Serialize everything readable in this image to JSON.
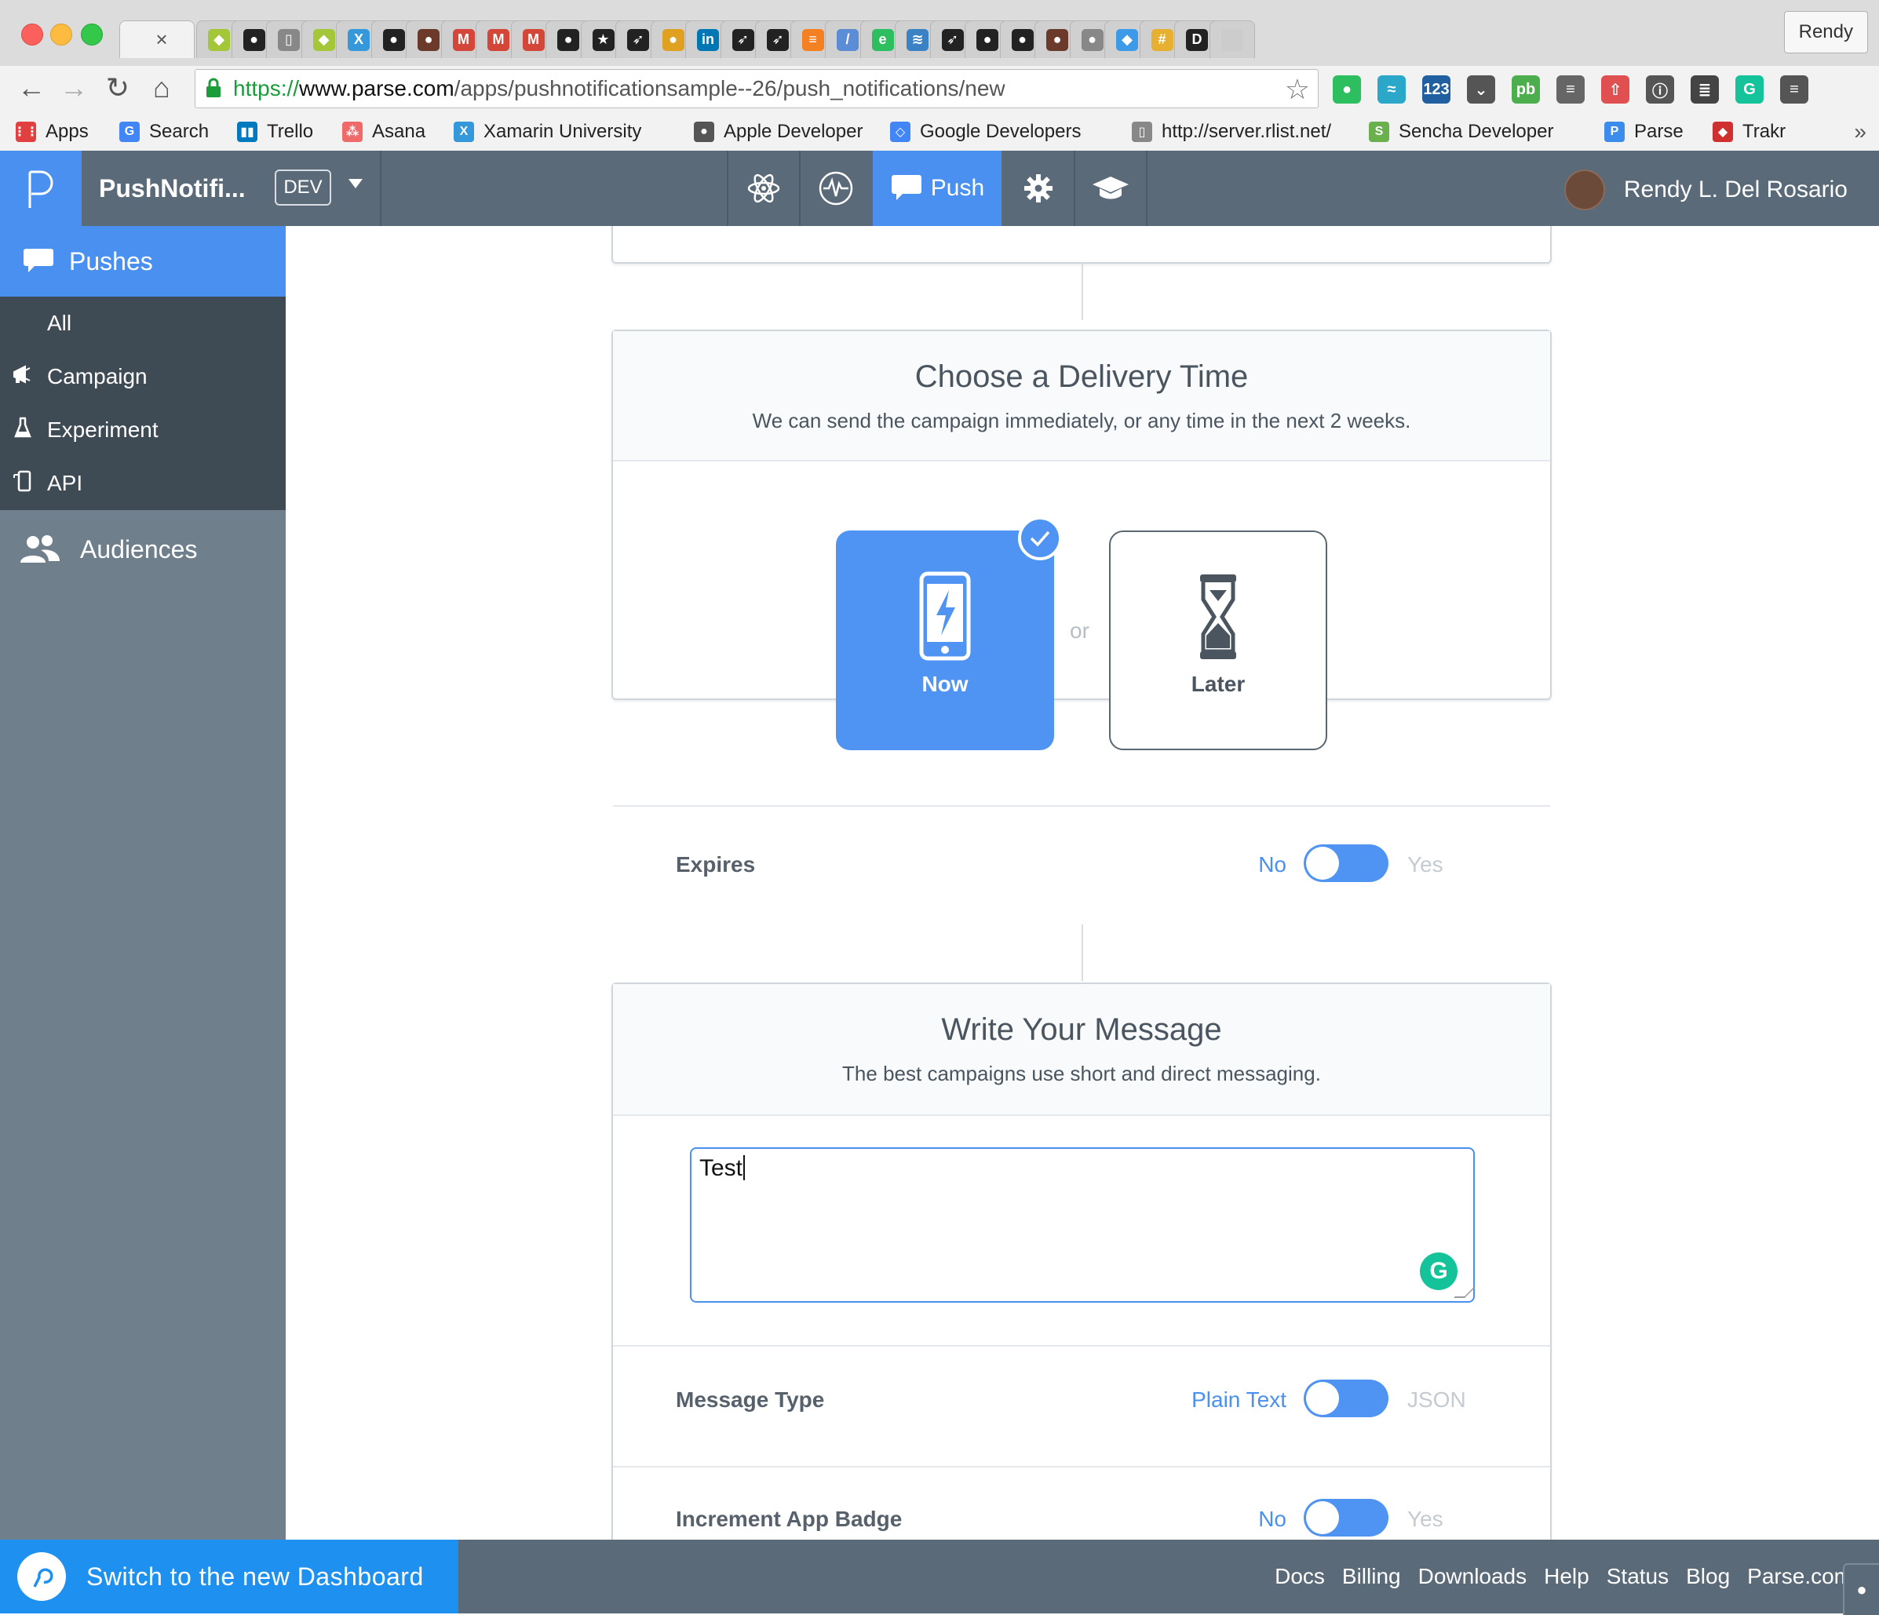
{
  "browser": {
    "profile_name": "Rendy",
    "url_scheme": "https://",
    "url_host": "www.parse.com",
    "url_path": "/apps/pushnotificationsample--26/push_notifications/new",
    "tab_close_glyph": "×",
    "tabs": [
      {
        "icon": "android-icon",
        "color": "#a4c639",
        "glyph": "◆"
      },
      {
        "icon": "github-icon",
        "color": "#222222",
        "glyph": "●"
      },
      {
        "icon": "document-icon",
        "color": "#888888",
        "glyph": "▯"
      },
      {
        "icon": "android-icon",
        "color": "#a4c639",
        "glyph": "◆"
      },
      {
        "icon": "xamarin-icon",
        "color": "#3498db",
        "glyph": "X"
      },
      {
        "icon": "github-icon",
        "color": "#222222",
        "glyph": "●"
      },
      {
        "icon": "avatar-icon",
        "color": "#6b3a2a",
        "glyph": "●"
      },
      {
        "icon": "gmail-icon",
        "color": "#d44638",
        "glyph": "M"
      },
      {
        "icon": "gmail-icon",
        "color": "#d44638",
        "glyph": "M"
      },
      {
        "icon": "gmail-icon",
        "color": "#d44638",
        "glyph": "M"
      },
      {
        "icon": "github-icon",
        "color": "#222222",
        "glyph": "●"
      },
      {
        "icon": "star-box-icon",
        "color": "#222222",
        "glyph": "★"
      },
      {
        "icon": "rocket-icon",
        "color": "#222222",
        "glyph": "➶"
      },
      {
        "icon": "bear-icon",
        "color": "#e0a020",
        "glyph": "●"
      },
      {
        "icon": "linkedin-icon",
        "color": "#0077b5",
        "glyph": "in"
      },
      {
        "icon": "rocket-icon",
        "color": "#222222",
        "glyph": "➶"
      },
      {
        "icon": "rocket-icon",
        "color": "#222222",
        "glyph": "➶"
      },
      {
        "icon": "stackoverflow-icon",
        "color": "#f48024",
        "glyph": "≡"
      },
      {
        "icon": "pen-icon",
        "color": "#5b8dd6",
        "glyph": "/"
      },
      {
        "icon": "evernote-icon",
        "color": "#2dbe60",
        "glyph": "e"
      },
      {
        "icon": "buffer-icon",
        "color": "#3b82c4",
        "glyph": "≋"
      },
      {
        "icon": "rocket-icon",
        "color": "#222222",
        "glyph": "➶"
      },
      {
        "icon": "github-icon",
        "color": "#222222",
        "glyph": "●"
      },
      {
        "icon": "github-icon",
        "color": "#222222",
        "glyph": "●"
      },
      {
        "icon": "avatar-icon",
        "color": "#6b3a2a",
        "glyph": "●"
      },
      {
        "icon": "apple-icon",
        "color": "#888888",
        "glyph": "●"
      },
      {
        "icon": "dropbox-icon",
        "color": "#3d9ae8",
        "glyph": "◆"
      },
      {
        "icon": "slack-icon",
        "color": "#e8b030",
        "glyph": "#"
      },
      {
        "icon": "d-icon",
        "color": "#222222",
        "glyph": "D"
      },
      {
        "icon": "new-tab-icon",
        "color": "#cccccc",
        "glyph": ""
      }
    ],
    "extensions": [
      {
        "icon": "evernote-elephant-icon",
        "color": "#2dbe60",
        "glyph": "●"
      },
      {
        "icon": "wave-icon",
        "color": "#2aa7c9",
        "glyph": "≈"
      },
      {
        "icon": "counter-123-icon",
        "color": "#2060a0",
        "glyph": "123"
      },
      {
        "icon": "pocket-icon",
        "color": "#555555",
        "glyph": "⌄"
      },
      {
        "icon": "pushbullet-icon",
        "color": "#4cae4c",
        "glyph": "pb"
      },
      {
        "icon": "reader-icon",
        "color": "#666666",
        "glyph": "≡"
      },
      {
        "icon": "upload-icon",
        "color": "#e05050",
        "glyph": "⇧"
      },
      {
        "icon": "onepassword-icon",
        "color": "#555555",
        "glyph": "ⓘ"
      },
      {
        "icon": "ghostery-icon",
        "color": "#444444",
        "glyph": "≣"
      },
      {
        "icon": "grammarly-ext-icon",
        "color": "#15c39a",
        "glyph": "G"
      },
      {
        "icon": "menu-icon",
        "color": "#555555",
        "glyph": "≡"
      }
    ],
    "bookmarks": [
      {
        "label": "Apps",
        "icon": "apps-grid-icon",
        "color": "#e04040",
        "glyph": "⋮⋮"
      },
      {
        "label": "Search",
        "icon": "google-icon",
        "color": "#4285f4",
        "glyph": "G"
      },
      {
        "label": "Trello",
        "icon": "trello-icon",
        "color": "#0079bf",
        "glyph": "▮▮"
      },
      {
        "label": "Asana",
        "icon": "asana-icon",
        "color": "#f06a6a",
        "glyph": "⁂"
      },
      {
        "label": "Xamarin University",
        "icon": "xamarin-icon",
        "color": "#3498db",
        "glyph": "X"
      },
      {
        "label": "Apple Developer",
        "icon": "apple-icon",
        "color": "#555555",
        "glyph": "●"
      },
      {
        "label": "Google Developers",
        "icon": "google-dev-icon",
        "color": "#4285f4",
        "glyph": "◇"
      },
      {
        "label": "http://server.rlist.net/",
        "icon": "document-icon",
        "color": "#888888",
        "glyph": "▯"
      },
      {
        "label": "Sencha Developer",
        "icon": "sencha-icon",
        "color": "#6ab04c",
        "glyph": "S"
      },
      {
        "label": "Parse",
        "icon": "parse-icon",
        "color": "#3b8ced",
        "glyph": "P"
      },
      {
        "label": "Trakr",
        "icon": "trakr-icon",
        "color": "#d03030",
        "glyph": "◆"
      }
    ],
    "overflow_glyph": "»"
  },
  "topnav": {
    "app_name": "PushNotifi...",
    "env_label": "DEV",
    "push_label": "Push",
    "user_name": "Rendy L. Del Rosario"
  },
  "sidebar": {
    "pushes_label": "Pushes",
    "sub_items": [
      {
        "label": "All",
        "icon": ""
      },
      {
        "label": "Campaign",
        "icon": "megaphone-icon"
      },
      {
        "label": "Experiment",
        "icon": "flask-icon"
      },
      {
        "label": "API",
        "icon": "device-icon"
      }
    ],
    "audiences_label": "Audiences"
  },
  "delivery": {
    "title": "Choose a Delivery Time",
    "subtitle": "We can send the campaign immediately, or any time in the next 2 weeks.",
    "now_label": "Now",
    "or_label": "or",
    "later_label": "Later",
    "selected": "Now",
    "expires_label": "Expires",
    "expires_no": "No",
    "expires_yes": "Yes"
  },
  "message": {
    "title": "Write Your Message",
    "subtitle": "The best campaigns use short and direct messaging.",
    "text": "Test",
    "message_type_label": "Message Type",
    "message_type_plain": "Plain Text",
    "message_type_json": "JSON",
    "badge_label": "Increment App Badge",
    "badge_no": "No",
    "badge_yes": "Yes"
  },
  "footer": {
    "switch_label": "Switch to the new Dashboard",
    "links": [
      "Docs",
      "Billing",
      "Downloads",
      "Help",
      "Status",
      "Blog",
      "Parse.com"
    ]
  },
  "colors": {
    "accent": "#4a90f0",
    "nav_bg": "#5a6a78",
    "sidebar_bg": "#6f7f8c",
    "sidebar_sub_bg": "#3e4a54"
  }
}
